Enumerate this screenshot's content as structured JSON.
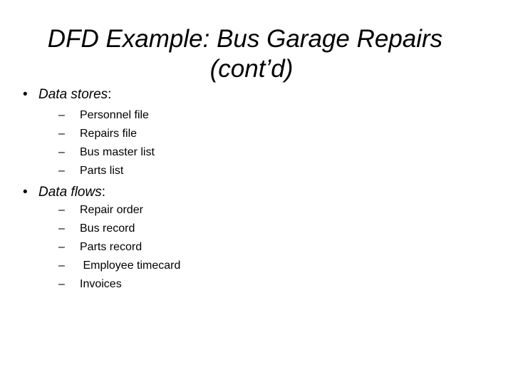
{
  "title": {
    "line1": "DFD Example: Bus Garage Repairs",
    "line2": "(cont’d)"
  },
  "sections": [
    {
      "bullet": "•",
      "label": "Data stores",
      "suffix": ":",
      "items": [
        "Personnel file",
        "Repairs file",
        "Bus master list",
        "Parts list"
      ]
    },
    {
      "bullet": "•",
      "label": "Data flows",
      "suffix": ":",
      "items": [
        "Repair order",
        "Bus record",
        "Parts record",
        " Employee timecard",
        "Invoices"
      ]
    }
  ],
  "dash": "–"
}
